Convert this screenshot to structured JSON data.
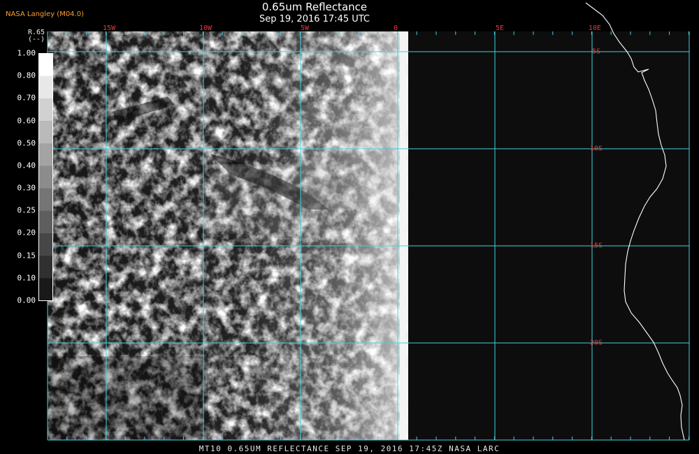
{
  "header": {
    "provider": "NASA Langley (M04.0)",
    "title": "0.65um Reflectance",
    "subtitle": "Sep 19, 2016 17:45 UTC"
  },
  "footer": {
    "caption": "MT10  0.65UM REFLECTANCE   SEP 19, 2016 17:45Z   NASA LARC"
  },
  "colorbar": {
    "label": "R.65",
    "unit": "(--)",
    "ticks": [
      "1.00",
      "0.80",
      "0.70",
      "0.60",
      "0.50",
      "0.40",
      "0.30",
      "0.25",
      "0.20",
      "0.15",
      "0.10",
      "0.00"
    ]
  },
  "map": {
    "longitude_labels": [
      "15W",
      "10W",
      "5W",
      "0",
      "5E",
      "10E"
    ],
    "latitude_labels": [
      "5S",
      "10S",
      "15S",
      "20S"
    ],
    "colors": {
      "grid": "#3fd3e0",
      "label": "#e23b3b",
      "coastline": "#ffffff",
      "background": "#000000",
      "provider": "#ff9d2e"
    }
  }
}
